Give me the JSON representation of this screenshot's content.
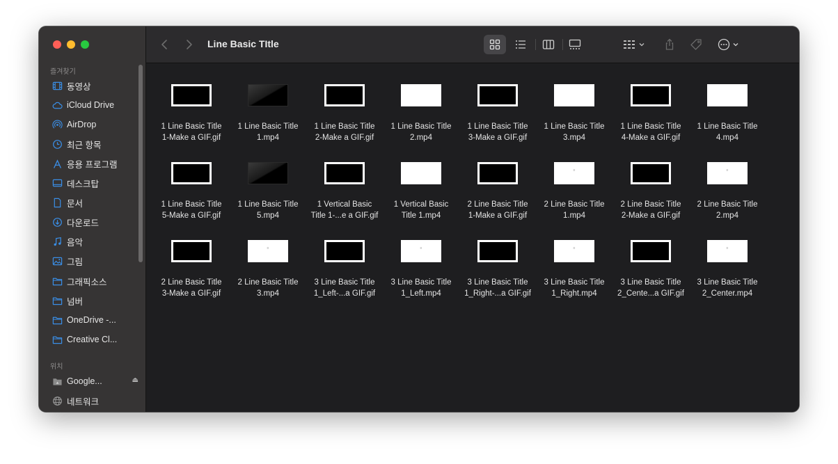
{
  "window": {
    "title": "Line Basic TItle"
  },
  "sidebar": {
    "favorites_label": "즐겨찾기",
    "locations_label": "위치",
    "items": [
      {
        "label": "동영상",
        "icon": "movies-icon"
      },
      {
        "label": "iCloud Drive",
        "icon": "cloud-icon"
      },
      {
        "label": "AirDrop",
        "icon": "airdrop-icon"
      },
      {
        "label": "최근 항목",
        "icon": "clock-icon"
      },
      {
        "label": "응용 프로그램",
        "icon": "applications-icon"
      },
      {
        "label": "데스크탑",
        "icon": "desktop-icon"
      },
      {
        "label": "문서",
        "icon": "document-icon"
      },
      {
        "label": "다운로드",
        "icon": "download-icon"
      },
      {
        "label": "음악",
        "icon": "music-icon"
      },
      {
        "label": "그림",
        "icon": "pictures-icon"
      },
      {
        "label": "그래픽소스",
        "icon": "folder-icon"
      },
      {
        "label": "넘버",
        "icon": "folder-icon"
      },
      {
        "label": "OneDrive -...",
        "icon": "folder-icon"
      },
      {
        "label": "Creative Cl...",
        "icon": "folder-icon"
      }
    ],
    "locations": [
      {
        "label": "Google...",
        "icon": "drive-icon"
      },
      {
        "label": "네트워크",
        "icon": "network-icon"
      }
    ]
  },
  "colors": {
    "accent": "#3a8ee6",
    "close": "#fe5f57",
    "minimize": "#febc2e",
    "zoom": "#28c840"
  },
  "files": [
    {
      "line1": "1 Line Basic Title",
      "line2": "1-Make a GIF.gif",
      "thumb": "black"
    },
    {
      "line1": "1 Line Basic Title",
      "line2": "1.mp4",
      "thumb": "dark"
    },
    {
      "line1": "1 Line Basic Title",
      "line2": "2-Make a GIF.gif",
      "thumb": "black"
    },
    {
      "line1": "1 Line Basic Title",
      "line2": "2.mp4",
      "thumb": "white"
    },
    {
      "line1": "1 Line Basic Title",
      "line2": "3-Make a GIF.gif",
      "thumb": "black"
    },
    {
      "line1": "1 Line Basic Title",
      "line2": "3.mp4",
      "thumb": "white"
    },
    {
      "line1": "1 Line Basic Title",
      "line2": "4-Make a GIF.gif",
      "thumb": "black"
    },
    {
      "line1": "1 Line Basic Title",
      "line2": "4.mp4",
      "thumb": "white"
    },
    {
      "line1": "1 Line Basic Title",
      "line2": "5-Make a GIF.gif",
      "thumb": "black"
    },
    {
      "line1": "1 Line Basic Title",
      "line2": "5.mp4",
      "thumb": "dark"
    },
    {
      "line1": "1 Vertical Basic",
      "line2": "Title 1-...e a GIF.gif",
      "thumb": "black"
    },
    {
      "line1": "1 Vertical Basic",
      "line2": "Title 1.mp4",
      "thumb": "white"
    },
    {
      "line1": "2 Line Basic Title",
      "line2": "1-Make a GIF.gif",
      "thumb": "black"
    },
    {
      "line1": "2 Line Basic Title",
      "line2": "1.mp4",
      "thumb": "white-txt"
    },
    {
      "line1": "2 Line Basic Title",
      "line2": "2-Make a GIF.gif",
      "thumb": "black"
    },
    {
      "line1": "2 Line Basic Title",
      "line2": "2.mp4",
      "thumb": "white-txt"
    },
    {
      "line1": "2 Line Basic Title",
      "line2": "3-Make a GIF.gif",
      "thumb": "black"
    },
    {
      "line1": "2 Line Basic Title",
      "line2": "3.mp4",
      "thumb": "white-txt"
    },
    {
      "line1": "3 Line Basic Title",
      "line2": "1_Left-...a GIF.gif",
      "thumb": "black"
    },
    {
      "line1": "3 Line Basic Title",
      "line2": "1_Left.mp4",
      "thumb": "white-txt"
    },
    {
      "line1": "3 Line Basic Title",
      "line2": "1_Right-...a GIF.gif",
      "thumb": "black"
    },
    {
      "line1": "3 Line Basic Title",
      "line2": "1_Right.mp4",
      "thumb": "white-txt"
    },
    {
      "line1": "3 Line Basic Title",
      "line2": "2_Cente...a GIF.gif",
      "thumb": "black"
    },
    {
      "line1": "3 Line Basic Title",
      "line2": "2_Center.mp4",
      "thumb": "white-txt"
    }
  ]
}
